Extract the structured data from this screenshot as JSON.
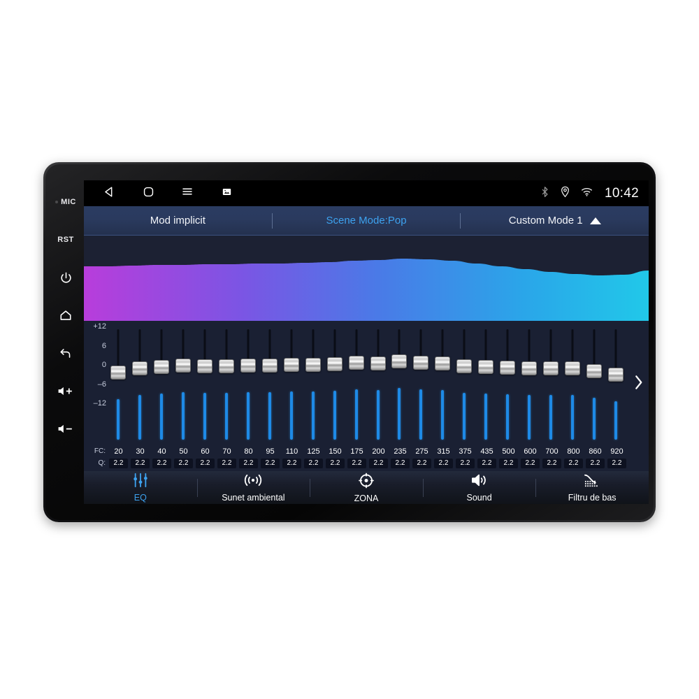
{
  "device": {
    "hardware_keys": [
      {
        "name": "mic",
        "label": "MIC"
      },
      {
        "name": "reset",
        "label": "RST"
      },
      {
        "name": "power",
        "label": ""
      },
      {
        "name": "home",
        "label": ""
      },
      {
        "name": "back",
        "label": ""
      },
      {
        "name": "volume-up",
        "label": ""
      },
      {
        "name": "volume-down",
        "label": ""
      }
    ]
  },
  "statusbar": {
    "nav": [
      {
        "name": "back-icon"
      },
      {
        "name": "home-icon"
      },
      {
        "name": "menu-icon"
      },
      {
        "name": "screenshot-icon"
      }
    ],
    "icons": [
      {
        "name": "bluetooth-icon"
      },
      {
        "name": "location-icon"
      },
      {
        "name": "wifi-icon"
      }
    ],
    "clock": "10:42"
  },
  "modebar": {
    "tabs": [
      {
        "label": "Mod implicit",
        "active": false
      },
      {
        "label": "Scene Mode:Pop",
        "active": true
      },
      {
        "label": "Custom Mode 1",
        "active": false
      }
    ],
    "expand_icon": "caret-up-icon"
  },
  "curve": {
    "gradient": [
      "#b83ddb",
      "#6f5ae6",
      "#3f7fe8",
      "#2ab5e8",
      "#23c6e8"
    ],
    "background": "#1c2133"
  },
  "equalizer": {
    "db_axis": [
      "+12",
      "6",
      "0",
      "-6",
      "-12"
    ],
    "db_min": -12,
    "db_max": 12,
    "row_label_fc": "FC:",
    "row_label_q": "Q:",
    "next_icon": "chevron-right-icon",
    "bands": [
      {
        "fc": "20",
        "q": "2.2",
        "gain": -0.7
      },
      {
        "fc": "30",
        "q": "2.2",
        "gain": 0.6
      },
      {
        "fc": "40",
        "q": "2.2",
        "gain": 1.1
      },
      {
        "fc": "50",
        "q": "2.2",
        "gain": 1.5
      },
      {
        "fc": "60",
        "q": "2.2",
        "gain": 1.3
      },
      {
        "fc": "70",
        "q": "2.2",
        "gain": 1.4
      },
      {
        "fc": "80",
        "q": "2.2",
        "gain": 1.5
      },
      {
        "fc": "95",
        "q": "2.2",
        "gain": 1.6
      },
      {
        "fc": "110",
        "q": "2.2",
        "gain": 1.7
      },
      {
        "fc": "125",
        "q": "2.2",
        "gain": 1.8
      },
      {
        "fc": "150",
        "q": "2.2",
        "gain": 1.9
      },
      {
        "fc": "175",
        "q": "2.2",
        "gain": 2.3
      },
      {
        "fc": "200",
        "q": "2.2",
        "gain": 2.2
      },
      {
        "fc": "235",
        "q": "2.2",
        "gain": 2.8
      },
      {
        "fc": "275",
        "q": "2.2",
        "gain": 2.4
      },
      {
        "fc": "315",
        "q": "2.2",
        "gain": 2.2
      },
      {
        "fc": "375",
        "q": "2.2",
        "gain": 1.4
      },
      {
        "fc": "435",
        "q": "2.2",
        "gain": 1.2
      },
      {
        "fc": "500",
        "q": "2.2",
        "gain": 0.9
      },
      {
        "fc": "600",
        "q": "2.2",
        "gain": 0.7
      },
      {
        "fc": "700",
        "q": "2.2",
        "gain": 0.7
      },
      {
        "fc": "800",
        "q": "2.2",
        "gain": 0.7
      },
      {
        "fc": "860",
        "q": "2.2",
        "gain": -0.3
      },
      {
        "fc": "920",
        "q": "2.2",
        "gain": -1.2
      }
    ]
  },
  "funcbar": {
    "items": [
      {
        "label": "EQ",
        "icon": "equalizer-icon",
        "active": true
      },
      {
        "label": "Sunet ambiental",
        "icon": "surround-sound-icon",
        "active": false
      },
      {
        "label": "ZONA",
        "icon": "zone-target-icon",
        "active": false
      },
      {
        "label": "Sound",
        "icon": "speaker-icon",
        "active": false
      },
      {
        "label": "Filtru de bas",
        "icon": "bass-filter-icon",
        "active": false
      }
    ]
  },
  "colors": {
    "accent": "#3da2ef",
    "slider_lit": "#1e8ae6",
    "screen_bg": "#1a2033",
    "statusbar_bg": "#000000"
  }
}
